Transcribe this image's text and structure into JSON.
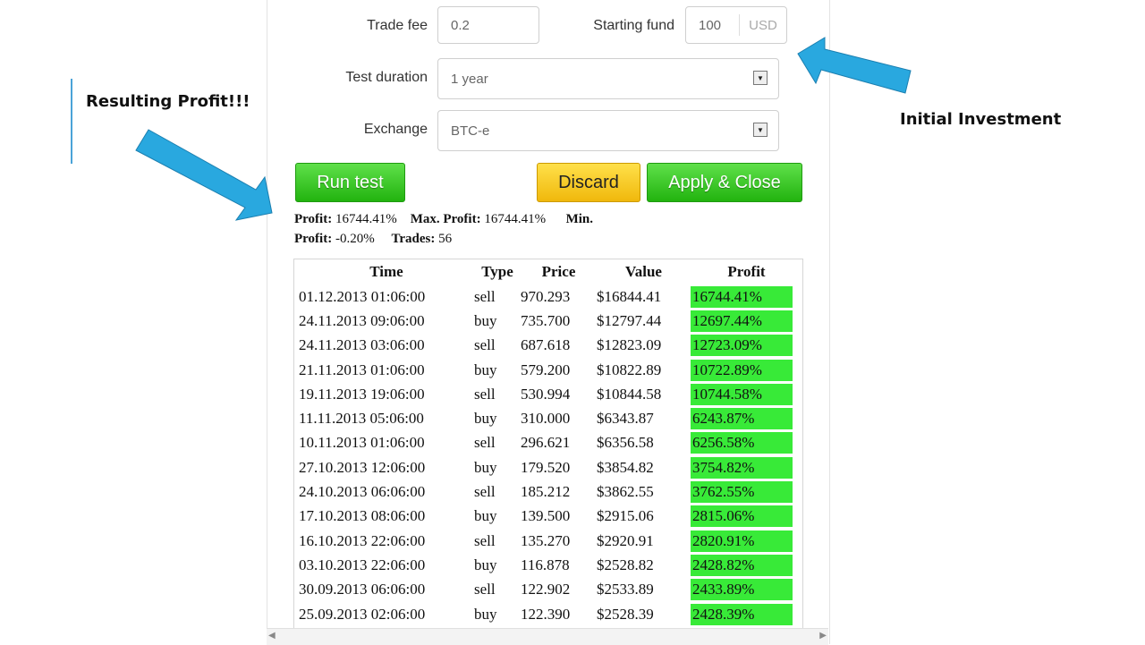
{
  "annotations": {
    "left_note": "Resulting Profit!!!",
    "right_note": "Initial Investment",
    "accent_color": "#29a8df"
  },
  "form": {
    "trade_fee_label": "Trade fee",
    "trade_fee_value": "0.2",
    "starting_fund_label": "Starting fund",
    "starting_fund_value": "100",
    "starting_fund_unit": "USD",
    "test_duration_label": "Test duration",
    "test_duration_value": "1 year",
    "exchange_label": "Exchange",
    "exchange_value": "BTC-e"
  },
  "buttons": {
    "run_test": "Run test",
    "discard": "Discard",
    "apply_close": "Apply & Close"
  },
  "summary": {
    "profit_label": "Profit:",
    "profit_value": "16744.41%",
    "max_profit_label": "Max. Profit:",
    "max_profit_value": "16744.41%",
    "min_profit_label_1": "Min.",
    "min_profit_label_2": "Profit:",
    "min_profit_value": "-0.20%",
    "trades_label": "Trades:",
    "trades_value": "56"
  },
  "table": {
    "headers": [
      "Time",
      "Type",
      "Price",
      "Value",
      "Profit"
    ],
    "rows": [
      [
        "01.12.2013 01:06:00",
        "sell",
        "970.293",
        "$16844.41",
        "16744.41%"
      ],
      [
        "24.11.2013 09:06:00",
        "buy",
        "735.700",
        "$12797.44",
        "12697.44%"
      ],
      [
        "24.11.2013 03:06:00",
        "sell",
        "687.618",
        "$12823.09",
        "12723.09%"
      ],
      [
        "21.11.2013 01:06:00",
        "buy",
        "579.200",
        "$10822.89",
        "10722.89%"
      ],
      [
        "19.11.2013 19:06:00",
        "sell",
        "530.994",
        "$10844.58",
        "10744.58%"
      ],
      [
        "11.11.2013 05:06:00",
        "buy",
        "310.000",
        "$6343.87",
        "6243.87%"
      ],
      [
        "10.11.2013 01:06:00",
        "sell",
        "296.621",
        "$6356.58",
        "6256.58%"
      ],
      [
        "27.10.2013 12:06:00",
        "buy",
        "179.520",
        "$3854.82",
        "3754.82%"
      ],
      [
        "24.10.2013 06:06:00",
        "sell",
        "185.212",
        "$3862.55",
        "3762.55%"
      ],
      [
        "17.10.2013 08:06:00",
        "buy",
        "139.500",
        "$2915.06",
        "2815.06%"
      ],
      [
        "16.10.2013 22:06:00",
        "sell",
        "135.270",
        "$2920.91",
        "2820.91%"
      ],
      [
        "03.10.2013 22:06:00",
        "buy",
        "116.878",
        "$2528.82",
        "2428.82%"
      ],
      [
        "30.09.2013 06:06:00",
        "sell",
        "122.902",
        "$2533.89",
        "2433.89%"
      ],
      [
        "25.09.2013 02:06:00",
        "buy",
        "122.390",
        "$2528.39",
        "2428.39%"
      ]
    ],
    "profit_highlight_color": "#38ea38"
  }
}
